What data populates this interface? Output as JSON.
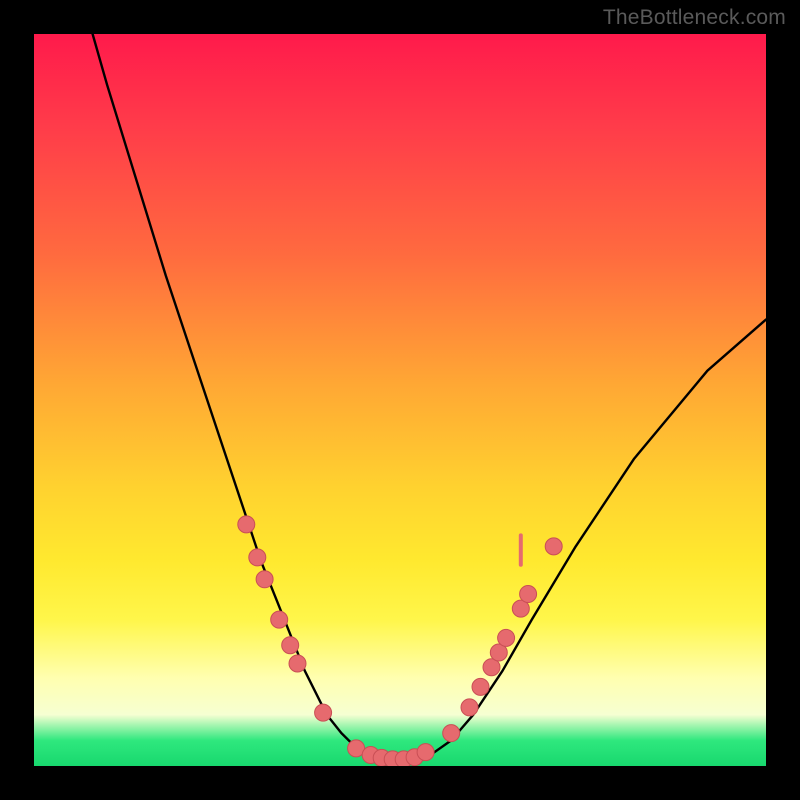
{
  "watermark": "TheBottleneck.com",
  "colors": {
    "frame": "#000000",
    "curve": "#000000",
    "marker_fill": "#e66a6e",
    "marker_stroke": "#c94f55",
    "gradient_top": "#ff1a4b",
    "gradient_bottom": "#18d86e"
  },
  "chart_data": {
    "type": "line",
    "title": "",
    "xlabel": "",
    "ylabel": "",
    "xlim": [
      0,
      100
    ],
    "ylim": [
      0,
      100
    ],
    "grid": false,
    "note": "Axes hidden; values estimated from pixel positions. y≈0 at bottom, y≈100 at top.",
    "series": [
      {
        "name": "curve",
        "x": [
          8,
          10,
          14,
          18,
          22,
          26,
          29,
          31,
          33,
          35,
          37,
          38.5,
          40,
          42,
          44,
          46,
          48,
          50,
          52,
          54,
          57,
          60,
          64,
          68,
          74,
          82,
          92,
          100
        ],
        "y": [
          100,
          93,
          80,
          67,
          55,
          43,
          34,
          28,
          23,
          18,
          13,
          10,
          7,
          4.5,
          2.5,
          1.4,
          0.9,
          0.8,
          0.9,
          1.4,
          3.5,
          7,
          13,
          20,
          30,
          42,
          54,
          61
        ]
      }
    ],
    "markers": [
      {
        "x": 29.0,
        "y": 33.0
      },
      {
        "x": 30.5,
        "y": 28.5
      },
      {
        "x": 31.5,
        "y": 25.5
      },
      {
        "x": 33.5,
        "y": 20.0
      },
      {
        "x": 35.0,
        "y": 16.5
      },
      {
        "x": 36.0,
        "y": 14.0
      },
      {
        "x": 39.5,
        "y": 7.3
      },
      {
        "x": 44.0,
        "y": 2.4
      },
      {
        "x": 46.0,
        "y": 1.5
      },
      {
        "x": 47.5,
        "y": 1.1
      },
      {
        "x": 49.0,
        "y": 0.9
      },
      {
        "x": 50.5,
        "y": 0.9
      },
      {
        "x": 52.0,
        "y": 1.2
      },
      {
        "x": 53.5,
        "y": 1.9
      },
      {
        "x": 57.0,
        "y": 4.5
      },
      {
        "x": 59.5,
        "y": 8.0
      },
      {
        "x": 61.0,
        "y": 10.8
      },
      {
        "x": 62.5,
        "y": 13.5
      },
      {
        "x": 63.5,
        "y": 15.5
      },
      {
        "x": 64.5,
        "y": 17.5
      },
      {
        "x": 66.5,
        "y": 21.5
      },
      {
        "x": 67.5,
        "y": 23.5
      },
      {
        "x": 71.0,
        "y": 30.0
      }
    ],
    "annotations": [
      {
        "type": "vertical_tick",
        "x": 66.5,
        "y": 29.5,
        "len": 4
      }
    ]
  }
}
